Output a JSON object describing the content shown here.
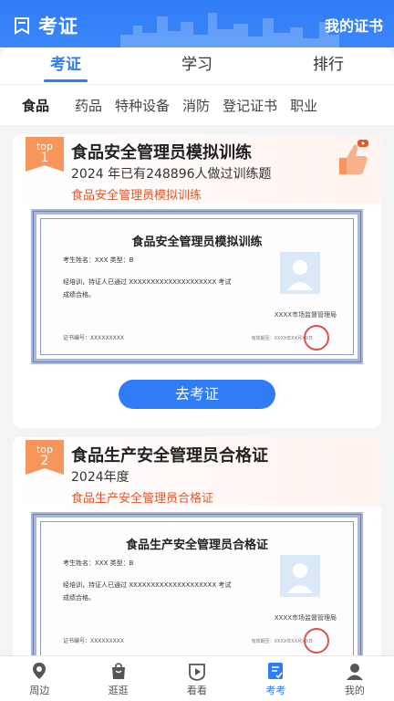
{
  "header": {
    "title": "考证",
    "right_link": "我的证书"
  },
  "top_tabs": [
    {
      "label": "考证",
      "active": true
    },
    {
      "label": "学习",
      "active": false
    },
    {
      "label": "排行",
      "active": false
    }
  ],
  "categories": [
    "食品",
    "药品",
    "特种设备",
    "消防",
    "登记证书",
    "职业"
  ],
  "cards": [
    {
      "rank_prefix": "top",
      "rank": "1",
      "title": "食品安全管理员模拟训练",
      "subtitle": "2024 年已有248896人做过训练题",
      "tag": "食品安全管理员模拟训练",
      "cert": {
        "title": "食品安全管理员模拟训练",
        "name_line": "考生姓名：XXX      类型：B",
        "text_line": "经培训，持证人已通过  XXXXXXXXXXXXXXXXXXXX  考试",
        "text_line2": "成绩合格。",
        "issuer": "XXXX市场监督管理局",
        "cert_no": "证书编号：XXXXXXXXX",
        "date": "有效期至：XXXX年XX月XX日"
      },
      "button_label": "去考证"
    },
    {
      "rank_prefix": "top",
      "rank": "2",
      "title": "食品生产安全管理员合格证",
      "subtitle": "2024年度",
      "tag": "食品生产安全管理员合格证",
      "cert": {
        "title": "食品生产安全管理员合格证",
        "name_line": "考生姓名：XXX      类型：B",
        "text_line": "经培训，持证人已通过  XXXXXXXXXXXXXXXXXXXX  考试",
        "text_line2": "成绩合格。",
        "issuer": "XXXX市场监督管理局",
        "cert_no": "证书编号：XXXXXXXXX",
        "date": "有效期至：XXXX年XX月XX日"
      }
    }
  ],
  "bottom_nav": [
    {
      "label": "周边",
      "icon": "location-icon",
      "active": false
    },
    {
      "label": "逛逛",
      "icon": "shopping-bag-icon",
      "active": false
    },
    {
      "label": "看看",
      "icon": "play-icon",
      "active": false
    },
    {
      "label": "考考",
      "icon": "exam-icon",
      "active": true
    },
    {
      "label": "我的",
      "icon": "profile-icon",
      "active": false
    }
  ],
  "colors": {
    "primary": "#2f7cf6",
    "accent": "#e4572e",
    "badge": "#f6955c"
  }
}
